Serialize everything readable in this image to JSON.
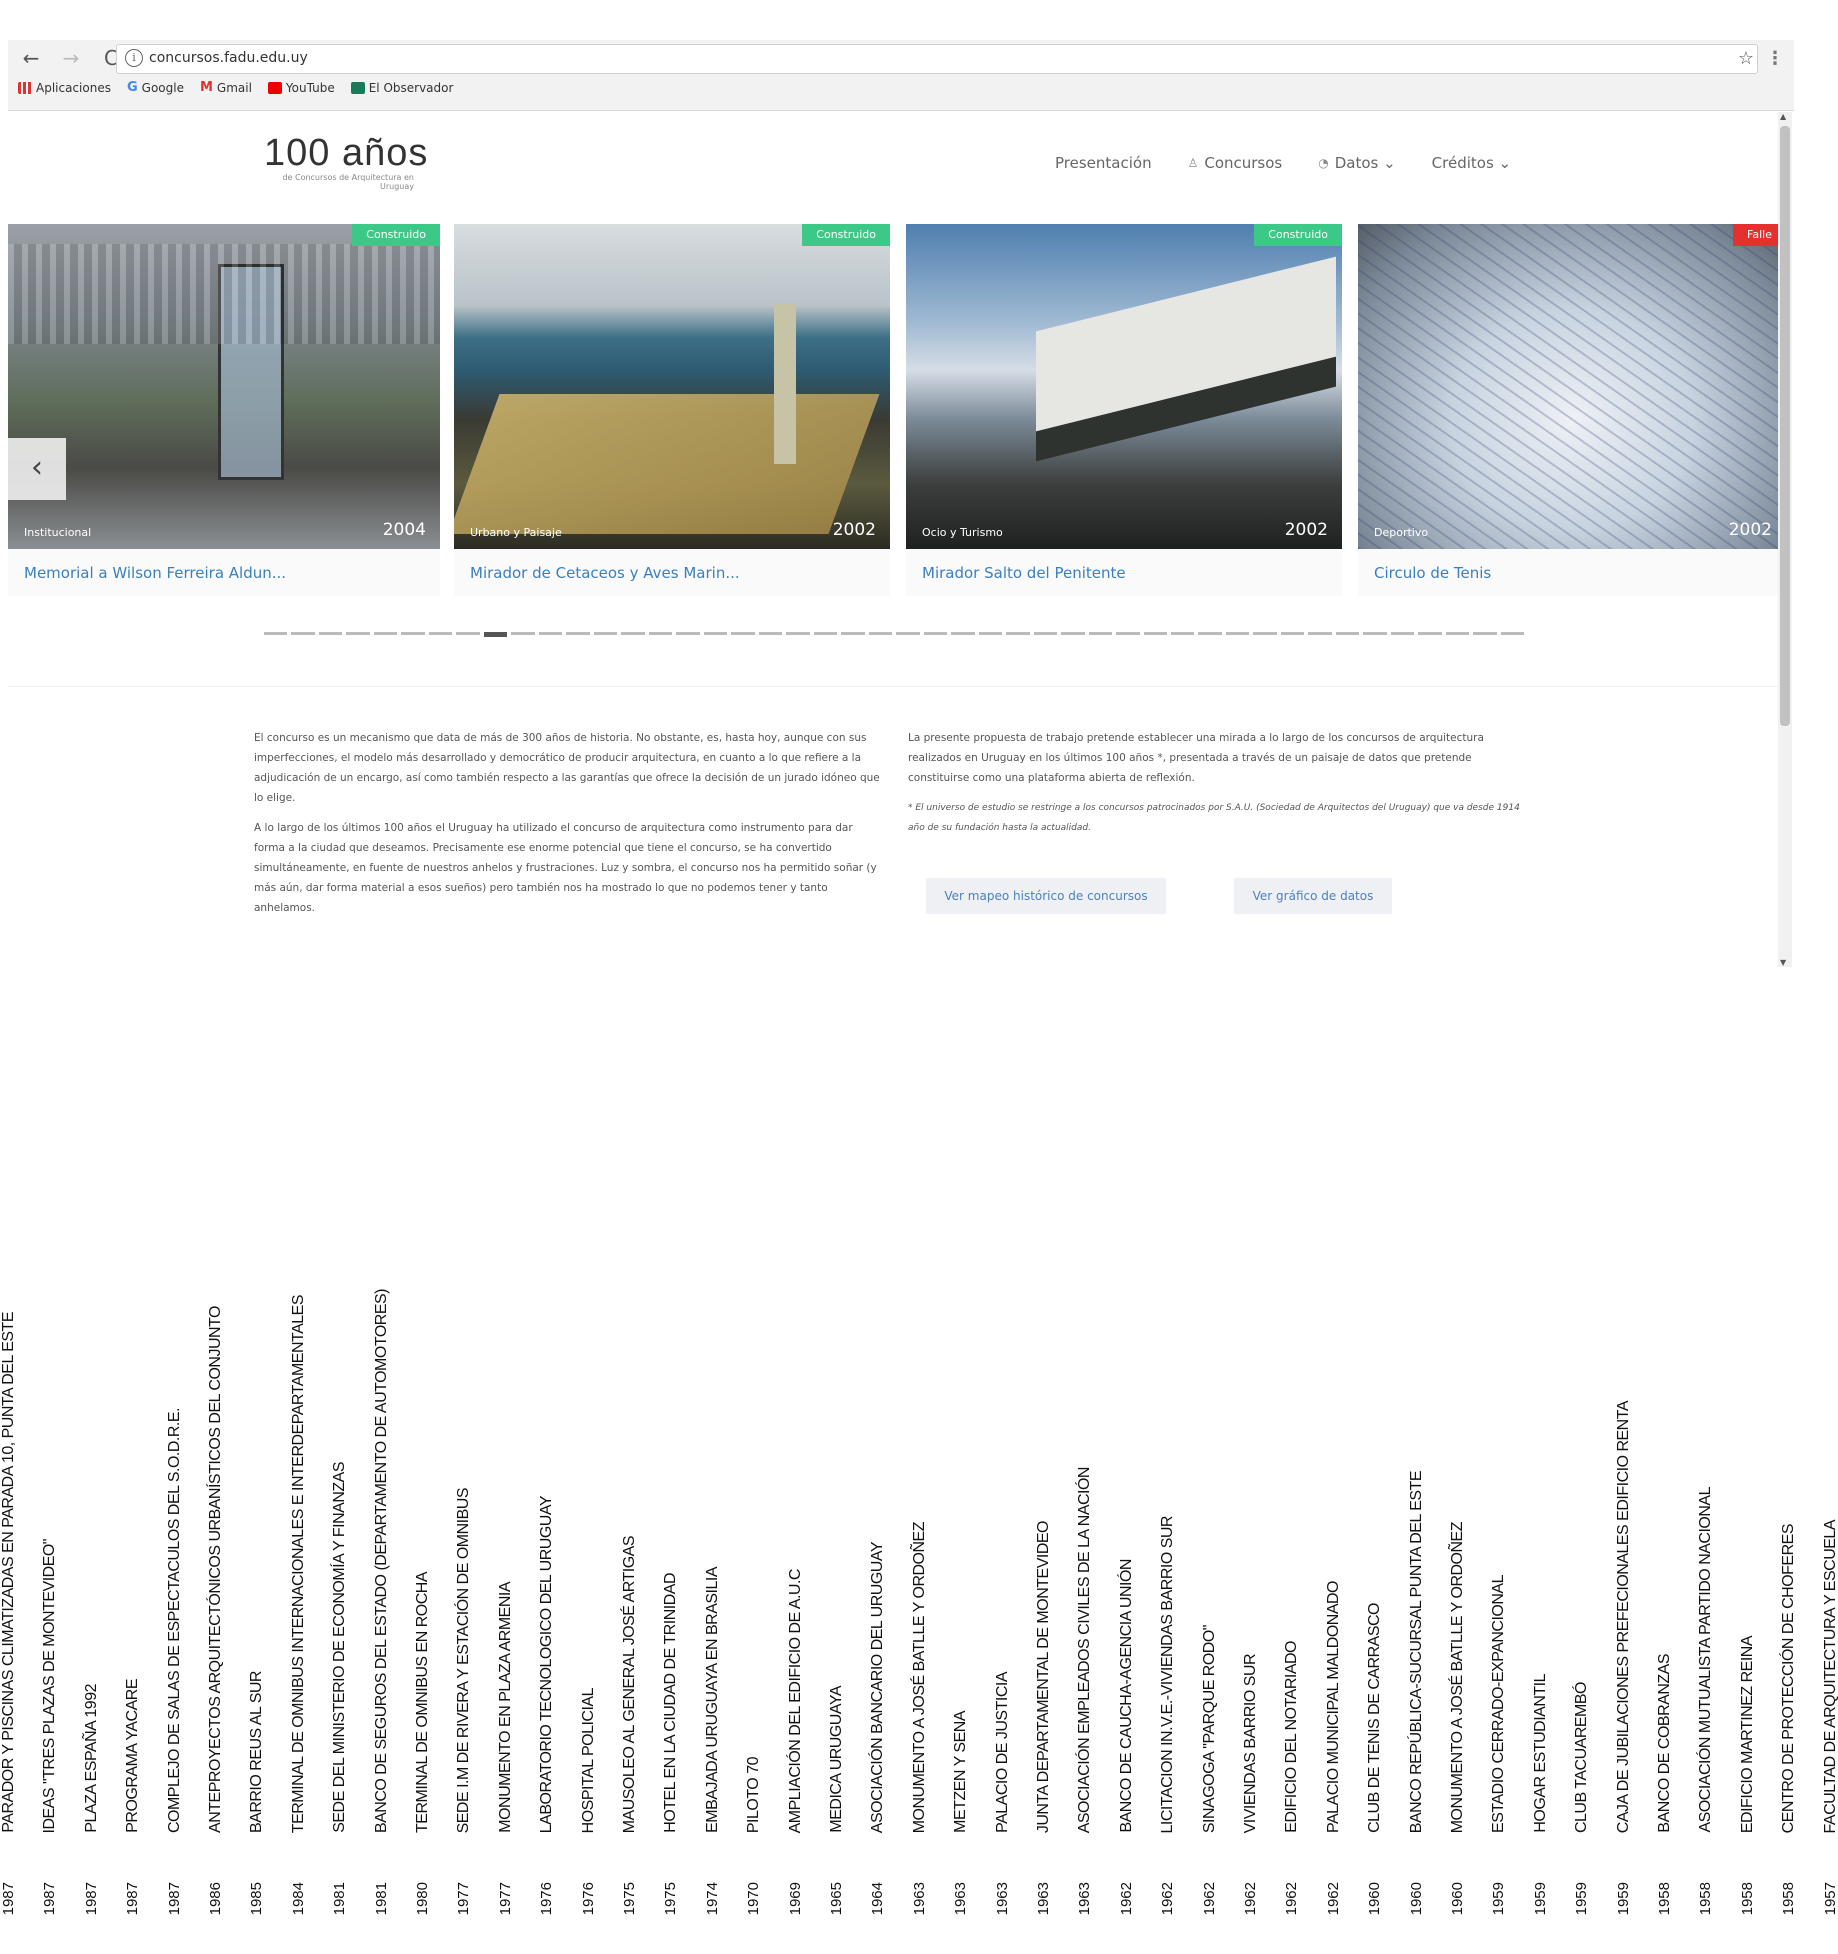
{
  "browser": {
    "url": "concursos.fadu.edu.uy",
    "bookmarks": [
      "Aplicaciones",
      "Google",
      "Gmail",
      "YouTube",
      "El Observador"
    ]
  },
  "site": {
    "logo_main": "100 años",
    "logo_sub": "de Concursos de Arquitectura en Uruguay",
    "nav": [
      {
        "label": "Presentación",
        "icon": ""
      },
      {
        "label": "Concursos",
        "icon": "person-icon"
      },
      {
        "label": "Datos ⌄",
        "icon": "pie-icon"
      },
      {
        "label": "Créditos ⌄",
        "icon": ""
      }
    ],
    "cards": [
      {
        "title": "Memorial a Wilson Ferreira Aldun...",
        "category": "Institucional",
        "year": "2004",
        "status": "Construido",
        "status_color": "#3cc987"
      },
      {
        "title": "Mirador de Cetaceos y Aves Marin...",
        "category": "Urbano y Paisaje",
        "year": "2002",
        "status": "Construido",
        "status_color": "#3cc987"
      },
      {
        "title": "Mirador Salto del Penitente",
        "category": "Ocio y Turismo",
        "year": "2002",
        "status": "Construido",
        "status_color": "#3cc987"
      },
      {
        "title": "Circulo de Tenis",
        "category": "Deportivo",
        "year": "2002",
        "status": "Falle",
        "status_color": "#e53030"
      }
    ],
    "intro_left": [
      "El concurso es un mecanismo que data de más de 300 años de historia. No obstante, es, hasta hoy, aunque con sus imperfecciones, el modelo más desarrollado y democrático de producir arquitectura, en cuanto a lo que refiere a la adjudicación de un encargo, así como también respecto a las garantías que ofrece la decisión de un jurado idóneo que lo elige.",
      "A lo largo de los últimos 100 años el Uruguay ha utilizado el concurso de arquitectura como instrumento para dar forma a la ciudad que deseamos. Precisamente ese enorme potencial que tiene el concurso, se ha convertido simultáneamente, en fuente de nuestros anhelos y frustraciones. Luz y sombra, el concurso nos ha permitido soñar (y más aún, dar forma material a esos sueños) pero también nos ha mostrado lo que no podemos tener y tanto anhelamos."
    ],
    "intro_right": "La presente propuesta de trabajo pretende establecer una mirada a lo largo de los concursos de arquitectura realizados en Uruguay en los últimos 100 años *, presentada a través de un paisaje de datos que pretende constituirse como una plataforma abierta de reflexión.",
    "intro_note": "* El universo de estudio se restringe a los concursos patrocinados por S.A.U. (Sociedad de Arquitectos del Uruguay) que va desde 1914 año de su fundación hasta la actualidad.",
    "buttons": [
      "Ver mapeo histórico de concursos",
      "Ver gráfico de datos"
    ]
  },
  "timeline_labels": [
    {
      "name": "PARADOR Y PISCINAS CLIMATIZADAS EN PARADA 10, PUNTA DEL ESTE",
      "year": "1987"
    },
    {
      "name": "IDEAS \"TRES PLAZAS DE MONTEVIDEO\"",
      "year": "1987"
    },
    {
      "name": "PLAZA ESPAÑA 1992",
      "year": "1987"
    },
    {
      "name": "PROGRAMA YACARE",
      "year": "1987"
    },
    {
      "name": "COMPLEJO DE SALAS DE ESPECTACULOS DEL S.O.D.R.E.",
      "year": "1987"
    },
    {
      "name": "ANTEPROYECTOS ARQUITECTÓNICOS URBANÍSTICOS DEL CONJUNTO",
      "year": "1986"
    },
    {
      "name": "BARRIO REUS AL SUR",
      "year": "1985"
    },
    {
      "name": "TERMINAL DE OMNIBUS INTERNACIONALES E INTERDEPARTAMENTALES",
      "year": "1984"
    },
    {
      "name": "SEDE DEL MINISTERIO DE ECONOMÍA Y FINANZAS",
      "year": "1981"
    },
    {
      "name": "BANCO DE SEGUROS DEL ESTADO (DEPARTAMENTO DE AUTOMOTORES)",
      "year": "1981"
    },
    {
      "name": "TERMINAL DE OMNIBUS EN ROCHA",
      "year": "1980"
    },
    {
      "name": "SEDE I.M DE RIVERA Y ESTACIÓN DE OMNIBUS",
      "year": "1977"
    },
    {
      "name": "MONUMENTO EN PLAZA ARMENIA",
      "year": "1977"
    },
    {
      "name": "LABORATORIO TECNOLOGICO DEL URUGUAY",
      "year": "1976"
    },
    {
      "name": "HOSPITAL POLICIAL",
      "year": "1976"
    },
    {
      "name": "MAUSOLEO AL GENERAL JOSÉ ARTIGAS",
      "year": "1975"
    },
    {
      "name": "HOTEL EN LA CIUDAD DE TRINIDAD",
      "year": "1975"
    },
    {
      "name": "EMBAJADA URUGUAYA EN BRASILIA",
      "year": "1974"
    },
    {
      "name": "PILOTO 70",
      "year": "1970"
    },
    {
      "name": "AMPLIACIÓN DEL EDIFICIO DE A.U.C",
      "year": "1969"
    },
    {
      "name": "MEDICA URUGUAYA",
      "year": "1965"
    },
    {
      "name": "ASOCIACIÓN BANCARIO DEL URUGUAY",
      "year": "1964"
    },
    {
      "name": "MONUMENTO A JOSÉ BATLLE Y ORDOÑEZ",
      "year": "1963"
    },
    {
      "name": "METZEN Y SENA",
      "year": "1963"
    },
    {
      "name": "PALACIO DE JUSTICIA",
      "year": "1963"
    },
    {
      "name": "JUNTA DEPARTAMENTAL DE MONTEVIDEO",
      "year": "1963"
    },
    {
      "name": "ASOCIACIÓN EMPLEADOS CIVILES DE LA NACIÓN",
      "year": "1963"
    },
    {
      "name": "BANCO DE CAUCHA-AGENCIA UNIÓN",
      "year": "1962"
    },
    {
      "name": "LICITACION IN.V.E.-VIVIENDAS BARRIO SUR",
      "year": "1962"
    },
    {
      "name": "SINAGOGA \"PARQUE RODO\"",
      "year": "1962"
    },
    {
      "name": "VIVIENDAS BARRIO SUR",
      "year": "1962"
    },
    {
      "name": "EDIFICIO DEL NOTARIADO",
      "year": "1962"
    },
    {
      "name": "PALACIO MUNICIPAL MALDONADO",
      "year": "1962"
    },
    {
      "name": "CLUB DE TENIS DE CARRASCO",
      "year": "1960"
    },
    {
      "name": "BANCO REPÚBLICA-SUCURSAL PUNTA DEL ESTE",
      "year": "1960"
    },
    {
      "name": "MONUMENTO A JOSÉ BATLLE Y ORDOÑEZ",
      "year": "1960"
    },
    {
      "name": "ESTADIO CERRADO-EXPANCIONAL",
      "year": "1959"
    },
    {
      "name": "HOGAR ESTUDIANTIL",
      "year": "1959"
    },
    {
      "name": "CLUB TACUAREMBÓ",
      "year": "1959"
    },
    {
      "name": "CAJA DE JUBILACIONES PREFECIONALES EDIFICIO RENTA",
      "year": "1959"
    },
    {
      "name": "BANCO DE COBRANZAS",
      "year": "1958"
    },
    {
      "name": "ASOCIACIÓN MUTUALISTA PARTIDO NACIONAL",
      "year": "1958"
    },
    {
      "name": "EDIFICIO MARTINEZ REINA",
      "year": "1958"
    },
    {
      "name": "CENTRO DE PROTECCIÓN DE CHOFERES",
      "year": "1958"
    },
    {
      "name": "FACULTAD DE ARQUITECTURA Y ESCUELA",
      "year": "1957"
    }
  ]
}
